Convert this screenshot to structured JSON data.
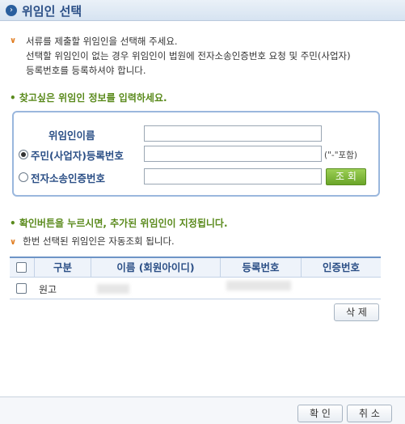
{
  "window": {
    "title": "위임인 선택"
  },
  "intro": {
    "line1": "서류를 제출할 위임인을 선택해 주세요.",
    "line2": "선택할 위임인이 없는 경우 위임인이 법원에 전자소송인증번호 요청 및 주민(사업자)",
    "line3": "등록번호를 등록하셔야 합니다."
  },
  "search": {
    "heading": "• 찾고싶은 위임인 정보를 입력하세요.",
    "name_label": "위임인이름",
    "rrn_label": "주민(사업자)등록번호",
    "rrn_hint": "(\"-\"포함)",
    "cert_label": "전자소송인증번호",
    "search_button": "조 회"
  },
  "notice": {
    "confirm_text": "• 확인버튼을 누르시면, 추가된 위임인이 지정됩니다.",
    "auto_text": "한번 선택된 위임인은 자동조회 됩니다."
  },
  "table": {
    "columns": [
      "구분",
      "이름 (회원아이디)",
      "등록번호",
      "인증번호"
    ],
    "rows": [
      {
        "type": "원고"
      }
    ]
  },
  "actions": {
    "delete_label": "삭 제",
    "ok_label": "확 인",
    "cancel_label": "취 소"
  },
  "colors": {
    "title_blue": "#2b4f86",
    "accent_green": "#5a8a1c",
    "chevron_orange": "#e07b1e"
  }
}
